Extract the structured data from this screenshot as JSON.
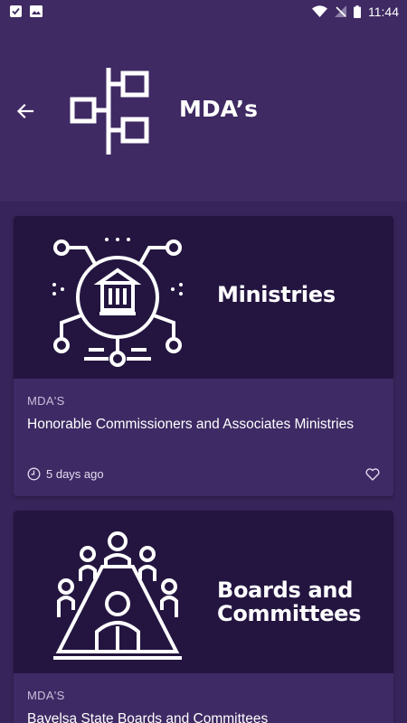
{
  "status_bar": {
    "time": "11:44",
    "left_icons": [
      "notification-icon",
      "image-icon"
    ],
    "right_icons": [
      "wifi-icon",
      "no-signal-icon",
      "battery-icon"
    ]
  },
  "header": {
    "title": "MDA’s",
    "back_icon": "arrow-back-icon",
    "icon": "hierarchy-icon"
  },
  "cards": [
    {
      "banner_title": "Ministries",
      "banner_icon": "government-network-icon",
      "category": "MDA'S",
      "title": "Honorable Commissioners and Associates Ministries",
      "time": "5 days ago"
    },
    {
      "banner_title": "Boards and Committees",
      "banner_icon": "boardroom-meeting-icon",
      "category": "MDA'S",
      "title": "Bayelsa State Boards and Committees"
    }
  ],
  "colors": {
    "background": "#37245a",
    "header": "#3f2a63",
    "card": "#3e2a64",
    "banner": "#241540",
    "muted_text": "#c9bedd"
  }
}
